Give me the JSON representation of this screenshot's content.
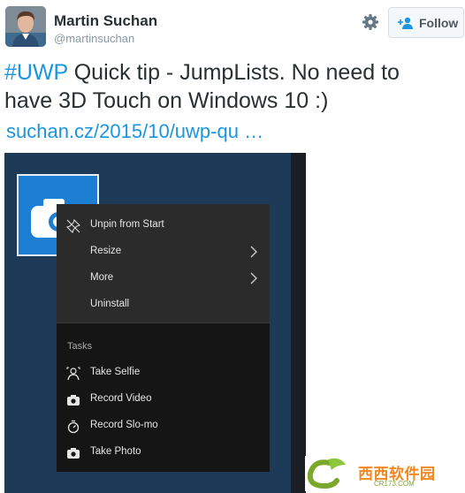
{
  "tweet": {
    "author_name": "Martin Suchan",
    "author_handle": "@martinsuchan",
    "follow_label": "Follow",
    "hashtag": "#UWP",
    "text_line1_rest": " Quick tip - JumpLists. No need to",
    "text_line2": "have 3D Touch on Windows 10 :)",
    "link_text": "suchan.cz/2015/10/uwp-qu …",
    "accent_color": "#1b95e0"
  },
  "screenshot": {
    "context_menu": [
      {
        "label": "Unpin from Start",
        "icon": "unpin-icon"
      },
      {
        "label": "Resize",
        "icon": "",
        "submenu": true
      },
      {
        "label": "More",
        "icon": "",
        "submenu": true
      },
      {
        "label": "Uninstall",
        "icon": ""
      }
    ],
    "tasks_header": "Tasks",
    "tasks": [
      {
        "label": "Take Selfie",
        "icon": "selfie-icon"
      },
      {
        "label": "Record Video",
        "icon": "camera-icon"
      },
      {
        "label": "Record Slo-mo",
        "icon": "timer-icon"
      },
      {
        "label": "Take Photo",
        "icon": "camera-icon"
      }
    ],
    "tile_icon": "camera-icon"
  },
  "watermark": {
    "brand": "西西软件园",
    "url": "CR173.COM"
  }
}
